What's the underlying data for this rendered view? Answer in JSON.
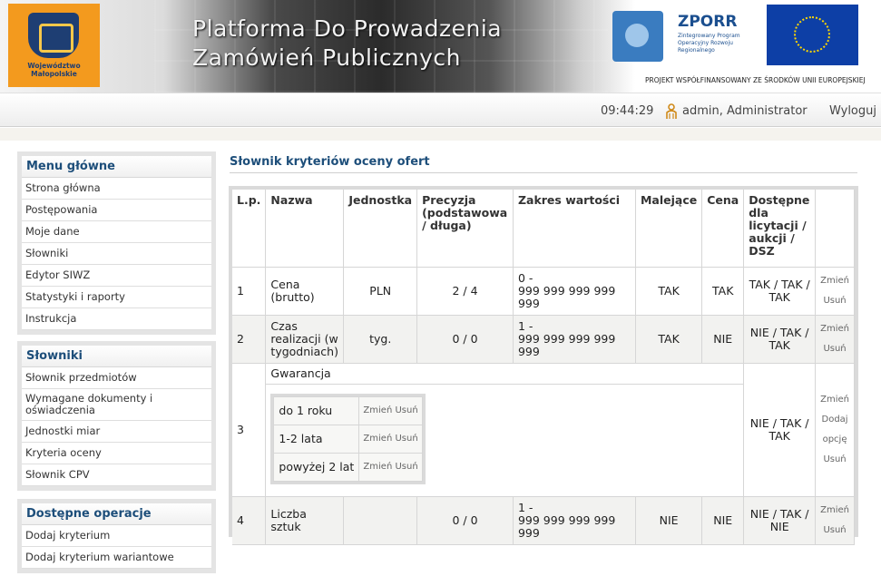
{
  "header": {
    "logo_text_line1": "Województwo",
    "logo_text_line2": "Małopolskie",
    "title_line1": "Platforma Do Prowadzenia",
    "title_line2": "Zamówień Publicznych",
    "zporr_name": "ZPORR",
    "zporr_desc": "Zintegrowany Program Operacyjny Rozwoju Regionalnego",
    "eu_caption": "PROJEKT WSPÓŁFINANSOWANY ZE ŚRODKÓW UNII EUROPEJSKIEJ"
  },
  "status": {
    "time": "09:44:29",
    "user": "admin, Administrator",
    "logout": "Wyloguj"
  },
  "sidebar": {
    "menu": {
      "title": "Menu główne",
      "items": [
        "Strona główna",
        "Postępowania",
        "Moje dane",
        "Słowniki",
        "Edytor SIWZ",
        "Statystyki i raporty",
        "Instrukcja"
      ]
    },
    "dictionaries": {
      "title": "Słowniki",
      "items": [
        "Słownik przedmiotów",
        "Wymagane dokumenty i oświadczenia",
        "Jednostki miar",
        "Kryteria oceny",
        "Słownik CPV"
      ]
    },
    "operations": {
      "title": "Dostępne operacje",
      "items": [
        "Dodaj kryterium",
        "Dodaj kryterium wariantowe"
      ]
    }
  },
  "main": {
    "title": "Słownik kryteriów oceny ofert",
    "columns": {
      "lp": "L.p.",
      "name": "Nazwa",
      "unit": "Jednostka",
      "precision": "Precyzja (podstawowa / długa)",
      "range": "Zakres wartości",
      "desc": "Malejące",
      "price": "Cena",
      "avail": "Dostępne dla licytacji / aukcji / DSZ"
    },
    "actions": {
      "edit": "Zmień",
      "delete": "Usuń",
      "add_option": "Dodaj opcję"
    },
    "rows": [
      {
        "lp": "1",
        "name": "Cena (brutto)",
        "unit": "PLN",
        "precision": "2 / 4",
        "range_min": "0 -",
        "range_max": "999 999 999 999 999",
        "desc": "TAK",
        "price": "TAK",
        "avail": "TAK / TAK / TAK"
      },
      {
        "lp": "2",
        "name": "Czas realizacji (w tygodniach)",
        "unit": "tyg.",
        "precision": "0 / 0",
        "range_min": "1 -",
        "range_max": "999 999 999 999 999",
        "desc": "TAK",
        "price": "NIE",
        "avail": "NIE / TAK / TAK"
      },
      {
        "lp": "3",
        "name": "Gwarancja",
        "avail": "NIE / TAK / TAK",
        "options": [
          "do 1 roku",
          "1-2 lata",
          "powyżej 2 lat"
        ]
      },
      {
        "lp": "4",
        "name": "Liczba sztuk",
        "unit": "",
        "precision": "0 / 0",
        "range_min": "1 -",
        "range_max": "999 999 999 999 999",
        "desc": "NIE",
        "price": "NIE",
        "avail": "NIE / TAK / NIE"
      }
    ]
  }
}
